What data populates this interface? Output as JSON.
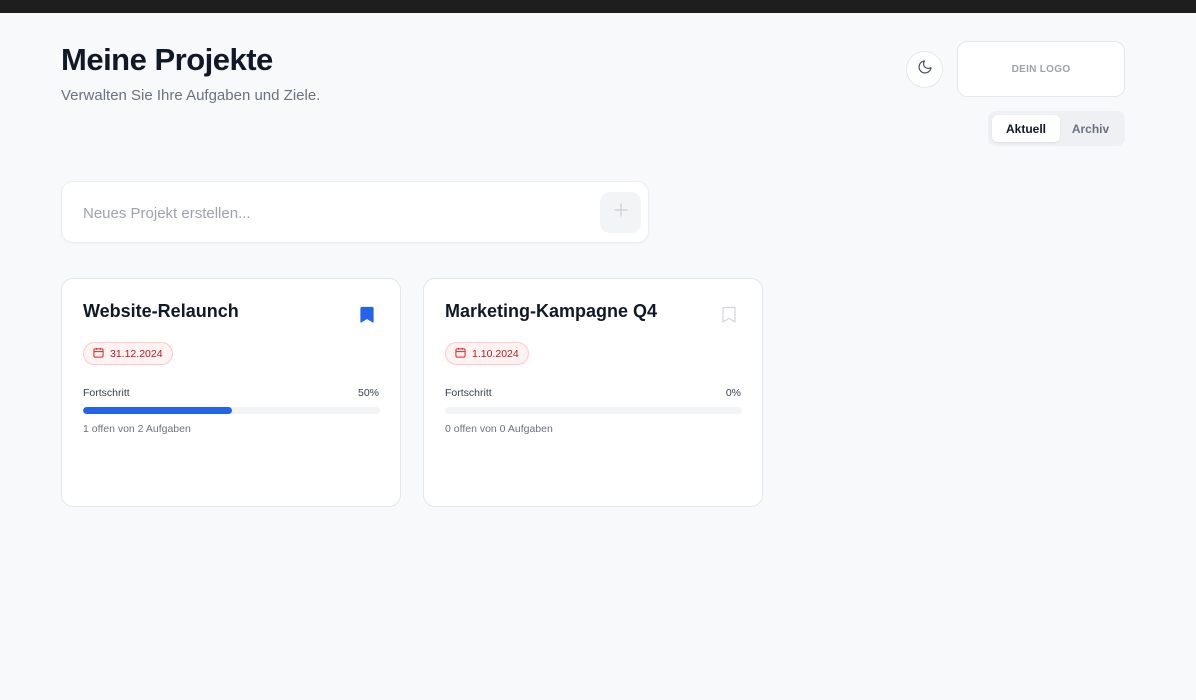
{
  "header": {
    "title": "Meine Projekte",
    "subtitle": "Verwalten Sie Ihre Aufgaben und Ziele."
  },
  "theme_toggle": {
    "icon": "moon-icon"
  },
  "logo": {
    "text": "DEIN LOGO"
  },
  "tabs": [
    {
      "label": "Aktuell",
      "active": true
    },
    {
      "label": "Archiv",
      "active": false
    }
  ],
  "new_project": {
    "placeholder": "Neues Projekt erstellen...",
    "value": "",
    "button_icon": "plus-icon"
  },
  "projects": [
    {
      "title": "Website-Relaunch",
      "bookmarked": true,
      "date": "31.12.2024",
      "progress_label": "Fortschritt",
      "progress_text": "50%",
      "progress": 50,
      "tasks_text": "1 offen von 2 Aufgaben"
    },
    {
      "title": "Marketing-Kampagne Q4",
      "bookmarked": false,
      "date": "1.10.2024",
      "progress_label": "Fortschritt",
      "progress_text": "0%",
      "progress": 0,
      "tasks_text": "0 offen von 0 Aufgaben"
    }
  ],
  "colors": {
    "accent": "#2563eb",
    "date_badge_text": "#b91c1c",
    "date_badge_bg": "#fef2f2",
    "background": "#f8f9fb"
  }
}
